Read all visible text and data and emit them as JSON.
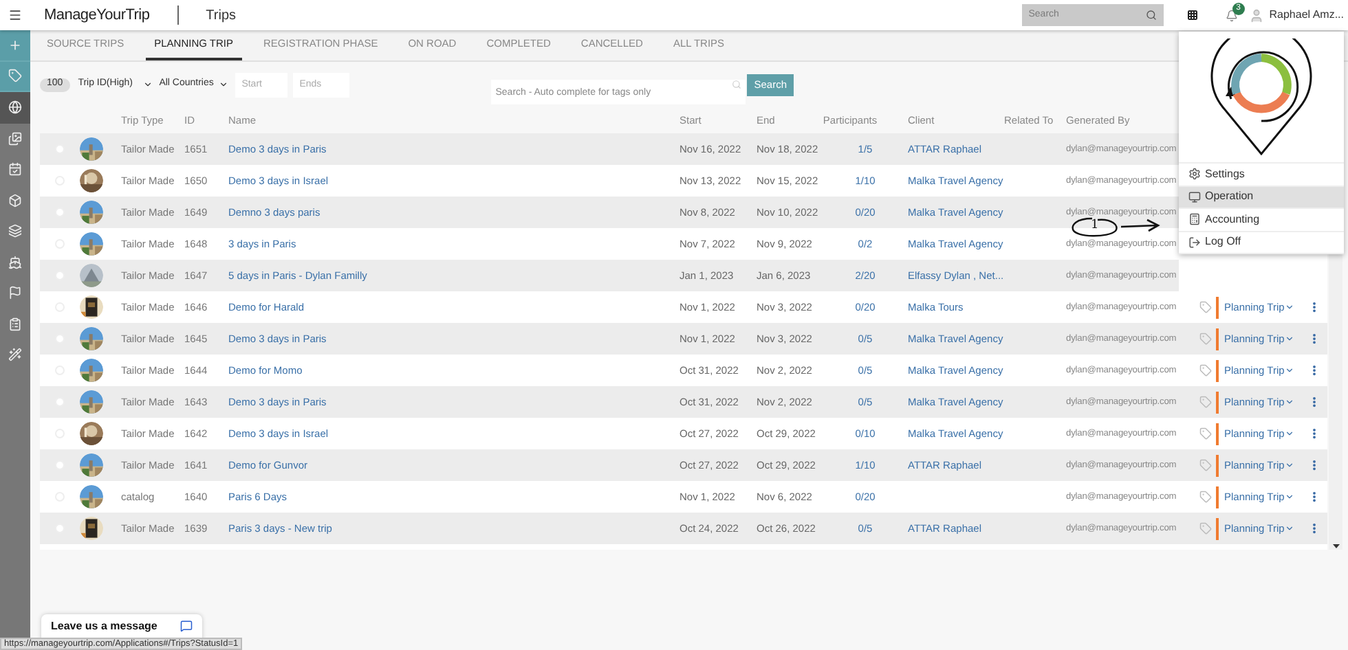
{
  "header": {
    "logo": "ManageYourTrip",
    "section": "Trips",
    "search": {
      "placeholder": "Search"
    },
    "notifications": "3",
    "user": "Raphael Amz..."
  },
  "sidebar": {
    "items": [
      {
        "kind": "action",
        "selected": false
      },
      {
        "kind": "action",
        "selected": false
      },
      {
        "kind": "nav",
        "selected": true
      },
      {
        "kind": "nav",
        "selected": false
      },
      {
        "kind": "nav",
        "selected": false
      },
      {
        "kind": "nav",
        "selected": false
      },
      {
        "kind": "nav",
        "selected": false
      },
      {
        "kind": "nav",
        "selected": false
      },
      {
        "kind": "nav",
        "selected": false
      },
      {
        "kind": "nav",
        "selected": false
      },
      {
        "kind": "nav",
        "selected": false
      }
    ]
  },
  "tabs": [
    {
      "label": "SOURCE TRIPS",
      "selected": false
    },
    {
      "label": "PLANNING TRIP",
      "selected": true
    },
    {
      "label": "REGISTRATION PHASE",
      "selected": false
    },
    {
      "label": "ON ROAD",
      "selected": false
    },
    {
      "label": "COMPLETED",
      "selected": false
    },
    {
      "label": "CANCELLED",
      "selected": false
    },
    {
      "label": "ALL TRIPS",
      "selected": false
    }
  ],
  "filters": {
    "count": "100",
    "sort": "Trip ID(High)",
    "country": "All Countries",
    "start": {
      "placeholder": "Start"
    },
    "end": {
      "placeholder": "Ends"
    },
    "search": {
      "placeholder": "Search - Auto complete for tags only"
    },
    "search_button": "Search"
  },
  "table": {
    "columns": [
      "Trip Type",
      "ID",
      "Name",
      "Start",
      "End",
      "Participants",
      "Client",
      "Related To",
      "Generated By"
    ],
    "rows": [
      {
        "checked": false,
        "trip_type": "Tailor Made",
        "id": "1651",
        "name": "Demo 3 days in Paris",
        "start": "Nov 16, 2022",
        "end": "Nov 18, 2022",
        "participants": "1/5",
        "client": "ATTAR Raphael",
        "generated_by": "dylan@manageyourtrip.com"
      },
      {
        "checked": false,
        "trip_type": "Tailor Made",
        "id": "1650",
        "name": "Demo 3 days in Israel",
        "start": "Nov 13, 2022",
        "end": "Nov 15, 2022",
        "participants": "1/10",
        "client": "Malka Travel Agency",
        "generated_by": "dylan@manageyourtrip.com"
      },
      {
        "checked": false,
        "trip_type": "Tailor Made",
        "id": "1649",
        "name": "Demno 3 days paris",
        "start": "Nov 8, 2022",
        "end": "Nov 10, 2022",
        "participants": "0/20",
        "client": "Malka Travel Agency",
        "generated_by": "dylan@manageyourtrip.com"
      },
      {
        "checked": false,
        "trip_type": "Tailor Made",
        "id": "1648",
        "name": "3 days in Paris",
        "start": "Nov 7, 2022",
        "end": "Nov 9, 2022",
        "participants": "0/2",
        "client": "Malka Travel Agency",
        "generated_by": "dylan@manageyourtrip.com"
      },
      {
        "checked": false,
        "trip_type": "Tailor Made",
        "id": "1647",
        "name": "5 days in Paris - Dylan Familly",
        "start": "Jan 1, 2023",
        "end": "Jan 6, 2023",
        "participants": "2/20",
        "client": "Elfassy Dylan , Net...",
        "generated_by": "dylan@manageyourtrip.com"
      },
      {
        "checked": false,
        "trip_type": "Tailor Made",
        "id": "1646",
        "name": "Demo for Harald",
        "start": "Nov 1, 2022",
        "end": "Nov 3, 2022",
        "participants": "0/20",
        "client": "Malka Tours",
        "generated_by": "dylan@manageyourtrip.com",
        "status": "Planning Trip"
      },
      {
        "checked": false,
        "trip_type": "Tailor Made",
        "id": "1645",
        "name": "Demo 3 days in Paris",
        "start": "Nov 1, 2022",
        "end": "Nov 3, 2022",
        "participants": "0/5",
        "client": "Malka Travel Agency",
        "generated_by": "dylan@manageyourtrip.com",
        "status": "Planning Trip"
      },
      {
        "checked": false,
        "trip_type": "Tailor Made",
        "id": "1644",
        "name": "Demo for Momo",
        "start": "Oct 31, 2022",
        "end": "Nov 2, 2022",
        "participants": "0/5",
        "client": "Malka Travel Agency",
        "generated_by": "dylan@manageyourtrip.com",
        "status": "Planning Trip"
      },
      {
        "checked": false,
        "trip_type": "Tailor Made",
        "id": "1643",
        "name": "Demo 3 days in Paris",
        "start": "Oct 31, 2022",
        "end": "Nov 2, 2022",
        "participants": "0/5",
        "client": "Malka Travel Agency",
        "generated_by": "dylan@manageyourtrip.com",
        "status": "Planning Trip"
      },
      {
        "checked": false,
        "trip_type": "Tailor Made",
        "id": "1642",
        "name": "Demo 3 days in Israel",
        "start": "Oct 27, 2022",
        "end": "Oct 29, 2022",
        "participants": "0/10",
        "client": "Malka Travel Agency",
        "generated_by": "dylan@manageyourtrip.com",
        "status": "Planning Trip"
      },
      {
        "checked": false,
        "trip_type": "Tailor Made",
        "id": "1641",
        "name": "Demo for Gunvor",
        "start": "Oct 27, 2022",
        "end": "Oct 29, 2022",
        "participants": "1/10",
        "client": "ATTAR Raphael",
        "generated_by": "dylan@manageyourtrip.com",
        "status": "Planning Trip"
      },
      {
        "checked": false,
        "trip_type": "catalog",
        "id": "1640",
        "name": "Paris 6 Days",
        "start": "Nov 1, 2022",
        "end": "Nov 6, 2022",
        "participants": "0/20",
        "generated_by": "dylan@manageyourtrip.com",
        "status": "Planning Trip"
      },
      {
        "checked": false,
        "trip_type": "Tailor Made",
        "id": "1639",
        "name": "Paris 3 days - New trip",
        "start": "Oct 24, 2022",
        "end": "Oct 26, 2022",
        "participants": "0/5",
        "client": "ATTAR Raphael",
        "generated_by": "dylan@manageyourtrip.com",
        "status": "Planning Trip"
      }
    ]
  },
  "user_menu": {
    "items": [
      {
        "label": "Settings",
        "selected": false
      },
      {
        "label": "Operation",
        "selected": true
      },
      {
        "label": "Accounting",
        "selected": false
      },
      {
        "label": "Log Off",
        "selected": false
      }
    ]
  },
  "annotation": {
    "label": "1"
  },
  "chat_widget": {
    "label": "Leave us a message"
  },
  "status_url": "https://manageyourtrip.com/Applications#/Trips?StatusId=1"
}
